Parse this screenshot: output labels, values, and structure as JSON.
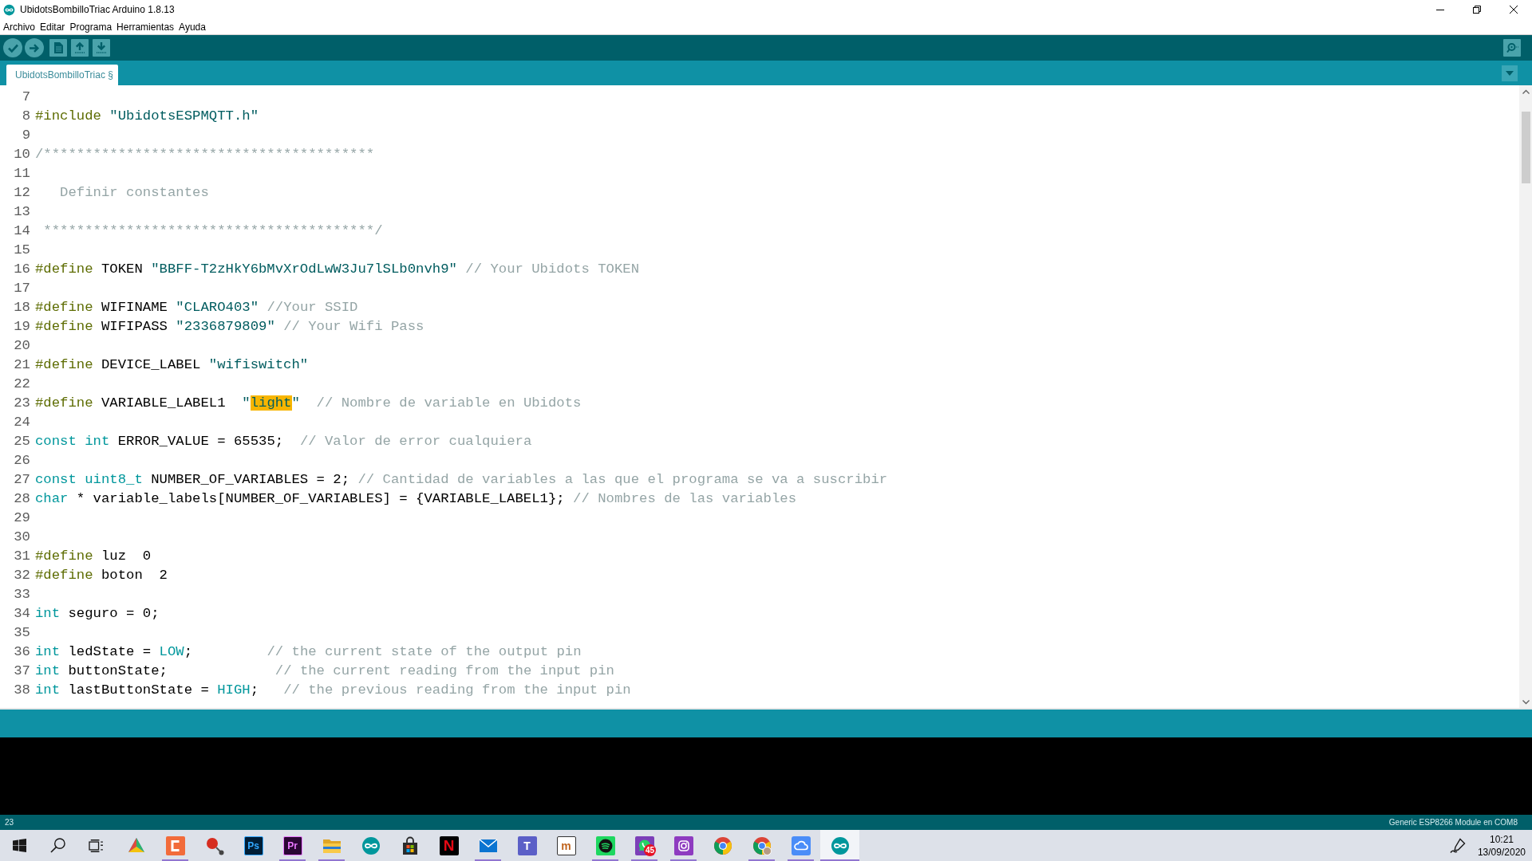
{
  "window": {
    "title": "UbidotsBombilloTriac Arduino 1.8.13"
  },
  "menu": [
    "Archivo",
    "Editar",
    "Programa",
    "Herramientas",
    "Ayuda"
  ],
  "tabs": [
    {
      "label": "UbidotsBombilloTriac §",
      "selected": true
    }
  ],
  "editor": {
    "lines": [
      {
        "number": "7"
      },
      {
        "number": "8",
        "tokens": [
          {
            "kind": "directive",
            "text": "#include"
          },
          {
            "kind": "string",
            "text": " \"UbidotsESPMQTT.h\""
          }
        ]
      },
      {
        "number": "9"
      },
      {
        "number": "10",
        "tokens": [
          {
            "kind": "comment",
            "text": "/****************************************"
          }
        ]
      },
      {
        "number": "11"
      },
      {
        "number": "12",
        "tokens": [
          {
            "kind": "comment",
            "text": "   Definir constantes"
          }
        ]
      },
      {
        "number": "13"
      },
      {
        "number": "14",
        "tokens": [
          {
            "kind": "comment",
            "text": " ****************************************/"
          }
        ]
      },
      {
        "number": "15"
      },
      {
        "number": "16",
        "tokens": [
          {
            "kind": "directive",
            "text": "#define"
          },
          {
            "kind": "plain",
            "text": " TOKEN "
          },
          {
            "kind": "string",
            "text": "\"BBFF-T2zHkY6bMvXrOdLwW3Ju7lSLb0nvh9\""
          },
          {
            "kind": "comment",
            "text": " // Your Ubidots TOKEN"
          }
        ]
      },
      {
        "number": "17"
      },
      {
        "number": "18",
        "tokens": [
          {
            "kind": "directive",
            "text": "#define"
          },
          {
            "kind": "plain",
            "text": " WIFINAME "
          },
          {
            "kind": "string",
            "text": "\"CLARO403\""
          },
          {
            "kind": "comment",
            "text": " //Your SSID"
          }
        ]
      },
      {
        "number": "19",
        "tokens": [
          {
            "kind": "directive",
            "text": "#define"
          },
          {
            "kind": "plain",
            "text": " WIFIPASS "
          },
          {
            "kind": "string",
            "text": "\"2336879809\""
          },
          {
            "kind": "comment",
            "text": " // Your Wifi Pass"
          }
        ]
      },
      {
        "number": "20"
      },
      {
        "number": "21",
        "tokens": [
          {
            "kind": "directive",
            "text": "#define"
          },
          {
            "kind": "plain",
            "text": " DEVICE_LABEL "
          },
          {
            "kind": "string",
            "text": "\"wifiswitch\""
          }
        ]
      },
      {
        "number": "22"
      },
      {
        "number": "23",
        "tokens": [
          {
            "kind": "directive",
            "text": "#define"
          },
          {
            "kind": "plain",
            "text": " VARIABLE_LABEL1  "
          },
          {
            "kind": "string",
            "text": "\""
          },
          {
            "kind": "match",
            "text": "light"
          },
          {
            "kind": "string",
            "text": "\""
          },
          {
            "kind": "comment",
            "text": "  // Nombre de variable en Ubidots"
          }
        ]
      },
      {
        "number": "24"
      },
      {
        "number": "25",
        "tokens": [
          {
            "kind": "keyword",
            "text": "const "
          },
          {
            "kind": "keyword",
            "text": "int"
          },
          {
            "kind": "plain",
            "text": " ERROR_VALUE = 65535;  "
          },
          {
            "kind": "comment",
            "text": "// Valor de error cualquiera"
          }
        ]
      },
      {
        "number": "26"
      },
      {
        "number": "27",
        "tokens": [
          {
            "kind": "keyword",
            "text": "const "
          },
          {
            "kind": "keyword",
            "text": "uint8_t"
          },
          {
            "kind": "plain",
            "text": " NUMBER_OF_VARIABLES = 2; "
          },
          {
            "kind": "comment",
            "text": "// Cantidad de variables a las que el programa se va a suscribir"
          }
        ]
      },
      {
        "number": "28",
        "tokens": [
          {
            "kind": "keyword",
            "text": "char"
          },
          {
            "kind": "plain",
            "text": " * variable_labels[NUMBER_OF_VARIABLES] = {VARIABLE_LABEL1}; "
          },
          {
            "kind": "comment",
            "text": "// Nombres de las variables"
          }
        ]
      },
      {
        "number": "29"
      },
      {
        "number": "30"
      },
      {
        "number": "31",
        "tokens": [
          {
            "kind": "directive",
            "text": "#define"
          },
          {
            "kind": "plain",
            "text": " luz  0"
          }
        ]
      },
      {
        "number": "32",
        "tokens": [
          {
            "kind": "directive",
            "text": "#define"
          },
          {
            "kind": "plain",
            "text": " boton  2"
          }
        ]
      },
      {
        "number": "33"
      },
      {
        "number": "34",
        "tokens": [
          {
            "kind": "keyword",
            "text": "int"
          },
          {
            "kind": "plain",
            "text": " seguro = 0;"
          }
        ]
      },
      {
        "number": "35"
      },
      {
        "number": "36",
        "tokens": [
          {
            "kind": "keyword",
            "text": "int"
          },
          {
            "kind": "plain",
            "text": " ledState = "
          },
          {
            "kind": "keyword",
            "text": "LOW"
          },
          {
            "kind": "plain",
            "text": ";         "
          },
          {
            "kind": "comment",
            "text": "// the current state of the output pin"
          }
        ]
      },
      {
        "number": "37",
        "tokens": [
          {
            "kind": "keyword",
            "text": "int"
          },
          {
            "kind": "plain",
            "text": " buttonState;             "
          },
          {
            "kind": "comment",
            "text": "// the current reading from the input pin"
          }
        ]
      },
      {
        "number": "38",
        "tokens": [
          {
            "kind": "keyword",
            "text": "int"
          },
          {
            "kind": "plain",
            "text": " lastButtonState = "
          },
          {
            "kind": "keyword",
            "text": "HIGH"
          },
          {
            "kind": "plain",
            "text": ";   "
          },
          {
            "kind": "comment",
            "text": "// the previous reading from the input pin"
          }
        ]
      }
    ]
  },
  "status_bar": {
    "line": "23",
    "board": "Generic ESP8266 Module en COM8"
  },
  "taskbar": {
    "apps": [
      {
        "running": false,
        "selected": false
      },
      {
        "running": true,
        "selected": false
      },
      {
        "running": false,
        "selected": false
      },
      {
        "glyph": "Ps",
        "running": false,
        "selected": false
      },
      {
        "glyph": "Pr",
        "running": true,
        "selected": false
      },
      {
        "running": true,
        "selected": false
      },
      {
        "running": false,
        "selected": false
      },
      {
        "running": false,
        "selected": false
      },
      {
        "glyph": "N",
        "running": false,
        "selected": false
      },
      {
        "running": true,
        "selected": false
      },
      {
        "glyph": "T",
        "running": false,
        "selected": false
      },
      {
        "glyph": "m",
        "running": false,
        "selected": false
      },
      {
        "running": true,
        "selected": false
      },
      {
        "badge": "45",
        "running": true,
        "selected": false
      },
      {
        "running": true,
        "selected": false
      },
      {
        "running": false,
        "selected": false
      },
      {
        "running": true,
        "selected": false
      },
      {
        "running": true,
        "selected": false
      },
      {
        "running": true,
        "selected": true
      }
    ],
    "clock": {
      "time": "10:21",
      "date": "13/09/2020"
    }
  }
}
